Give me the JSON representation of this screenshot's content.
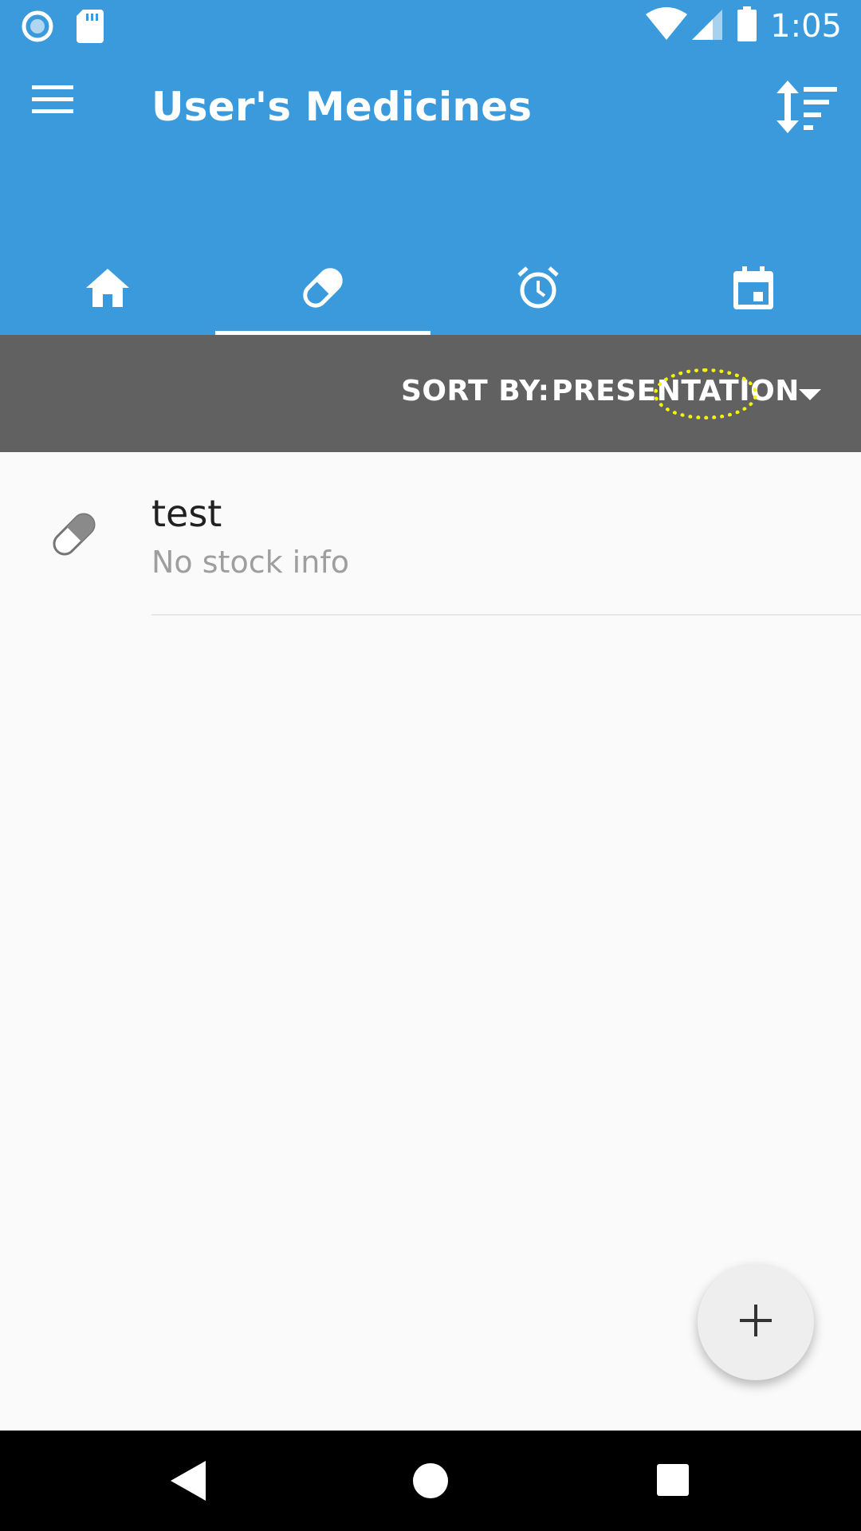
{
  "status_bar": {
    "time": "1:05",
    "icons": [
      "record-icon",
      "sd-card-icon",
      "wifi-icon",
      "signal-icon",
      "battery-icon"
    ]
  },
  "app_bar": {
    "title": "User's Medicines",
    "menu_icon": "menu-icon",
    "sort_icon": "sort-order-icon",
    "color": "#3a9adb"
  },
  "tabs": [
    {
      "name": "home",
      "icon": "home-icon",
      "active": false
    },
    {
      "name": "medicines",
      "icon": "pill-icon",
      "active": true
    },
    {
      "name": "alarms",
      "icon": "alarm-icon",
      "active": false
    },
    {
      "name": "calendar",
      "icon": "calendar-icon",
      "active": false
    }
  ],
  "sort_bar": {
    "label": "SORT BY:",
    "value": "PRESENTATION",
    "color": "#616161"
  },
  "medicines": [
    {
      "name": "test",
      "stock": "No stock info",
      "icon": "pill-icon"
    }
  ],
  "fab": {
    "icon": "plus-icon"
  },
  "nav_bar": {
    "icons": [
      "back-icon",
      "home-icon",
      "recents-icon"
    ]
  }
}
